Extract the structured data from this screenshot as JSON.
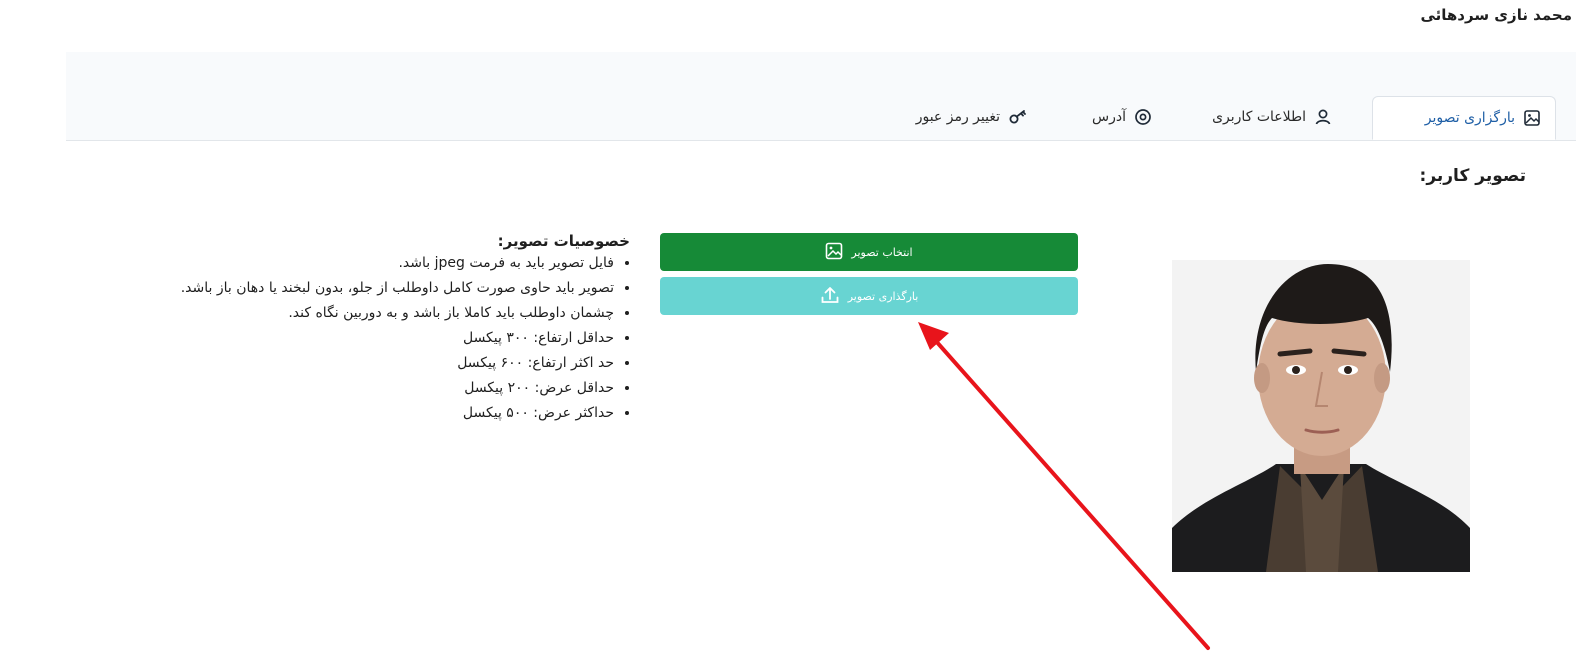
{
  "user": {
    "name": "محمد نازی سردهائی"
  },
  "tabs": [
    {
      "label": "بارگزاری تصویر",
      "icon": "image-icon",
      "active": true
    },
    {
      "label": "اطلاعات کاربری",
      "icon": "user-icon",
      "active": false
    },
    {
      "label": "آدرس",
      "icon": "location-pin-icon",
      "active": false
    },
    {
      "label": "تغییر رمز عبور",
      "icon": "key-icon",
      "active": false
    }
  ],
  "main": {
    "section_title": "تصویر کاربر:",
    "select_button_label": "انتخاب تصویر",
    "upload_button_label": "بارگذاری تصویر",
    "specs_title": "خصوصیات تصویر:",
    "specs": [
      "فایل تصویر باید به فرمت jpeg باشد.",
      "تصویر باید حاوی صورت کامل داوطلب از جلو، بدون لبخند یا دهان باز باشد.",
      "چشمان داوطلب باید کاملا باز باشد و به دوربین نگاه کند.",
      "حداقل ارتفاع: ۳۰۰ پیکسل",
      "حد اکثر ارتفاع: ۶۰۰ پیکسل",
      "حداقل عرض: ۲۰۰ پیکسل",
      "حداکثر عرض: ۵۰۰ پیکسل"
    ]
  },
  "colors": {
    "select_button": "#168a37",
    "upload_button": "#68d4d2",
    "active_tab_text": "#1f5fa6",
    "annotation_arrow": "#e8141b"
  }
}
